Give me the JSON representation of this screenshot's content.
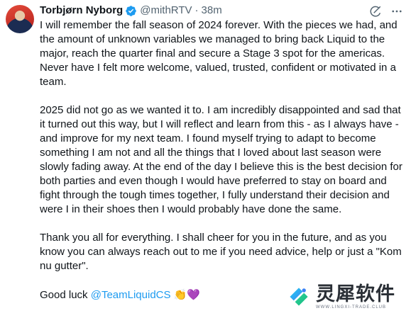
{
  "author": {
    "name": "Torbjørn Nyborg",
    "handle": "@mithRTV",
    "separator": "·",
    "time": "38m"
  },
  "icons": {
    "verified": "verified-badge-icon",
    "grok": "grok-icon",
    "more": "more-icon"
  },
  "tweet": {
    "paragraph_1": "I will remember the fall season of 2024 forever. With the pieces we had, and the amount of unknown variables we managed to bring back Liquid to the major, reach the quarter final and secure a Stage 3 spot for the americas. Never have I felt more welcome, valued, trusted, confident or motivated in a team.",
    "paragraph_2": "2025 did not go as we wanted it to. I am incredibly disappointed and sad that it turned out this way, but I will reflect and learn from this - as I always have - and improve for my next team. I found myself trying to adapt to become something I am not and all the things that I loved about last season were slowly fading away. At the end of the day I believe this is the best decision for both parties and even though I would have preferred to stay on board and fight through the tough times together, I fully understand their decision and were I in their shoes then I would probably have done the same.",
    "paragraph_3": "Thank you all for everything. I shall cheer for you in the future, and as you know you can always reach out to me if you need advice, help or just a \"Kom nu gutter\".",
    "closing_text": "Good luck ",
    "mention": "@TeamLiquidCS",
    "emoji_1": "👏",
    "emoji_2": "💜"
  },
  "watermark": {
    "title": "灵犀软件",
    "subtitle": "WWW.LINGXI-TRADE.CLUB"
  },
  "colors": {
    "accent": "#1d9bf0",
    "secondary_text": "#536471",
    "primary_text": "#0f1419"
  }
}
